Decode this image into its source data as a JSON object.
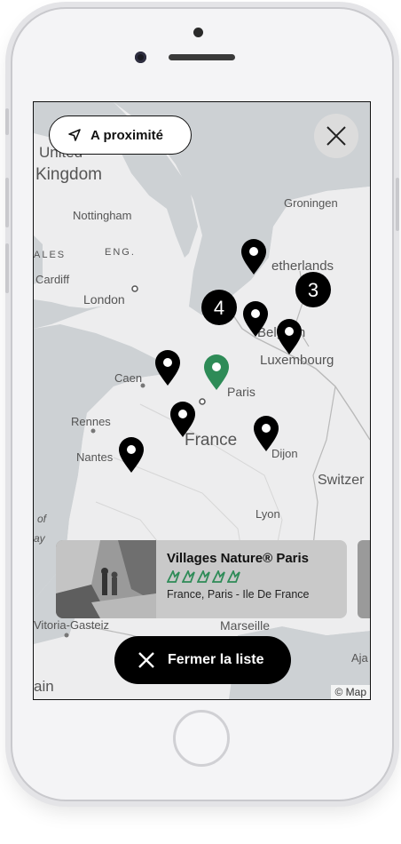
{
  "map": {
    "labels": {
      "united": "United",
      "kingdom": "Kingdom",
      "nottingham": "Nottingham",
      "eng": "ENG.",
      "ales": "ALES",
      "cardiff": "Cardiff",
      "london": "London",
      "groningen": "Groningen",
      "netherlands": "etherlands",
      "belgium": "Belgium",
      "luxembourg": "Luxembourg",
      "caen": "Caen",
      "paris": "Paris",
      "rennes": "Rennes",
      "france": "France",
      "nantes": "Nantes",
      "dijon": "Dijon",
      "switzerland": "Switzer",
      "lyon": "Lyon",
      "bay_of": "of",
      "bay_biscay": "ay",
      "vitoria": "Vitoria-Gasteiz",
      "marseille": "Marseille",
      "ajaccio": "Aja",
      "spain": "ain"
    },
    "clusters": [
      "4",
      "3"
    ],
    "attribution": "© Map"
  },
  "nearby_button": {
    "label": "A proximité"
  },
  "close_map_button": {
    "icon": "close-icon"
  },
  "card": {
    "title": "Villages Nature® Paris",
    "rating": 5,
    "location": "France, Paris - Ile De France"
  },
  "close_list_button": {
    "label": "Fermer la liste"
  },
  "colors": {
    "accent_green": "#2e8b57",
    "pin_black": "#000000"
  }
}
